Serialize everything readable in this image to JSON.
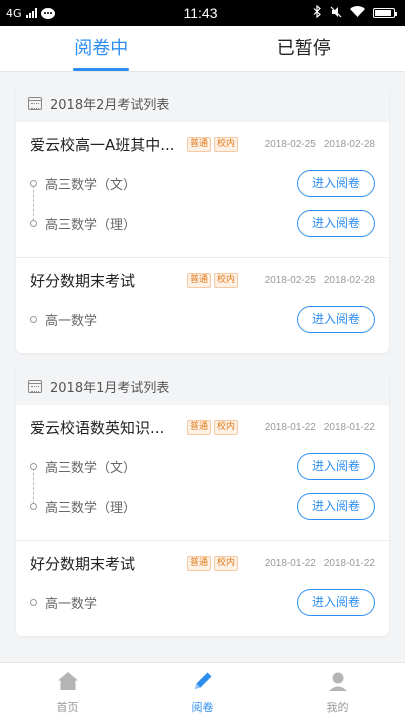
{
  "status_bar": {
    "network": "4G",
    "time": "11:43",
    "signal_bars": 4,
    "battery_level": 0.9,
    "icons": [
      "signal-icon",
      "chat-icon",
      "bluetooth-icon",
      "mute-icon",
      "wifi-icon",
      "battery-icon"
    ]
  },
  "tabs": [
    {
      "label": "阅卷中",
      "active": true
    },
    {
      "label": "已暂停",
      "active": false
    }
  ],
  "groups": [
    {
      "header": "2018年2月考试列表",
      "exams": [
        {
          "title": "爱云校高一A班其中...",
          "badges": [
            "普通",
            "校内"
          ],
          "start_date": "2018-02-25",
          "end_date": "2018-02-28",
          "subjects": [
            {
              "name": "高三数学（文）",
              "action": "进入阅卷"
            },
            {
              "name": "高三数学（理）",
              "action": "进入阅卷"
            }
          ]
        },
        {
          "title": "好分数期末考试",
          "badges": [
            "普通",
            "校内"
          ],
          "start_date": "2018-02-25",
          "end_date": "2018-02-28",
          "subjects": [
            {
              "name": "高一数学",
              "action": "进入阅卷"
            }
          ]
        }
      ]
    },
    {
      "header": "2018年1月考试列表",
      "exams": [
        {
          "title": "爱云校语数英知识...",
          "badges": [
            "普通",
            "校内"
          ],
          "start_date": "2018-01-22",
          "end_date": "2018-01-22",
          "subjects": [
            {
              "name": "高三数学（文）",
              "action": "进入阅卷"
            },
            {
              "name": "高三数学（理）",
              "action": "进入阅卷"
            }
          ]
        },
        {
          "title": "好分数期末考试",
          "badges": [
            "普通",
            "校内"
          ],
          "start_date": "2018-01-22",
          "end_date": "2018-01-22",
          "subjects": [
            {
              "name": "高一数学",
              "action": "进入阅卷"
            }
          ]
        }
      ]
    }
  ],
  "bottom_nav": [
    {
      "label": "首页",
      "icon": "home-icon",
      "active": false
    },
    {
      "label": "阅卷",
      "icon": "pen-icon",
      "active": true
    },
    {
      "label": "我的",
      "icon": "user-icon",
      "active": false
    }
  ],
  "colors": {
    "accent": "#2e8ef0",
    "badge_text": "#e37b1c",
    "background": "#f3f4f6"
  }
}
